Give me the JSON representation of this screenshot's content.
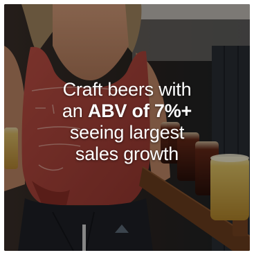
{
  "card": {
    "alt_subject": "Woman in a red tank top holding a flight of craft beers",
    "headline": {
      "line1": "Craft beers with",
      "line2_prefix": "an ",
      "line2_bold": "ABV of 7%+",
      "line3": "seeing largest",
      "line4": "sales growth"
    }
  },
  "colors": {
    "shirt": "#b2433a",
    "overlay": "#000000",
    "text": "#ffffff"
  }
}
